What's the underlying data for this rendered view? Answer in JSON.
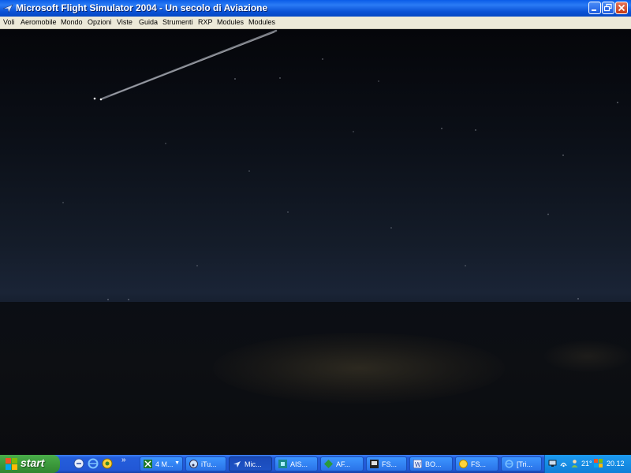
{
  "window": {
    "title": "Microsoft Flight Simulator 2004 - Un secolo di Aviazione",
    "app_icon": "plane-icon",
    "controls": [
      "minimize-icon",
      "restore-icon",
      "close-icon"
    ]
  },
  "menu": {
    "items": [
      "Voli",
      "Aeromobile",
      "Mondo",
      "Opzioni",
      "Viste",
      "Guida",
      "Strumenti",
      "RXP",
      "Modules",
      "Modules"
    ]
  },
  "taskbar": {
    "start_label": "start",
    "quick_launch": [
      "outlook-express-icon",
      "internet-explorer-icon",
      "media-icon"
    ],
    "more_glyph": "»",
    "tasks": [
      {
        "label": "4 M...",
        "icon": "excel-icon",
        "has_arrow": true,
        "active": false
      },
      {
        "label": "iTu...",
        "icon": "itunes-icon",
        "has_arrow": false,
        "active": false
      },
      {
        "label": "Mic...",
        "icon": "plane-icon",
        "has_arrow": false,
        "active": true
      },
      {
        "label": "AIS...",
        "icon": "app-icon",
        "has_arrow": false,
        "active": false
      },
      {
        "label": "AF...",
        "icon": "af-icon",
        "has_arrow": false,
        "active": false
      },
      {
        "label": "FS...",
        "icon": "fs-icon",
        "has_arrow": false,
        "active": false
      },
      {
        "label": "BO...",
        "icon": "word-icon",
        "has_arrow": false,
        "active": false
      },
      {
        "label": "FS...",
        "icon": "fs-sun-icon",
        "has_arrow": false,
        "active": false
      },
      {
        "label": "[Tri...",
        "icon": "internet-explorer-icon",
        "has_arrow": false,
        "active": false
      }
    ]
  },
  "tray": {
    "icons": [
      "network-icon",
      "wireless-icon",
      "user-icon",
      "flag-icon"
    ],
    "temperature": "21°",
    "clock": "20.12"
  },
  "colors": {
    "titlebar": "#0a5ce8",
    "menubar": "#ece9d8",
    "taskbar": "#245edb",
    "start_button": "#3c9a3c",
    "tray": "#0f7fd8"
  }
}
